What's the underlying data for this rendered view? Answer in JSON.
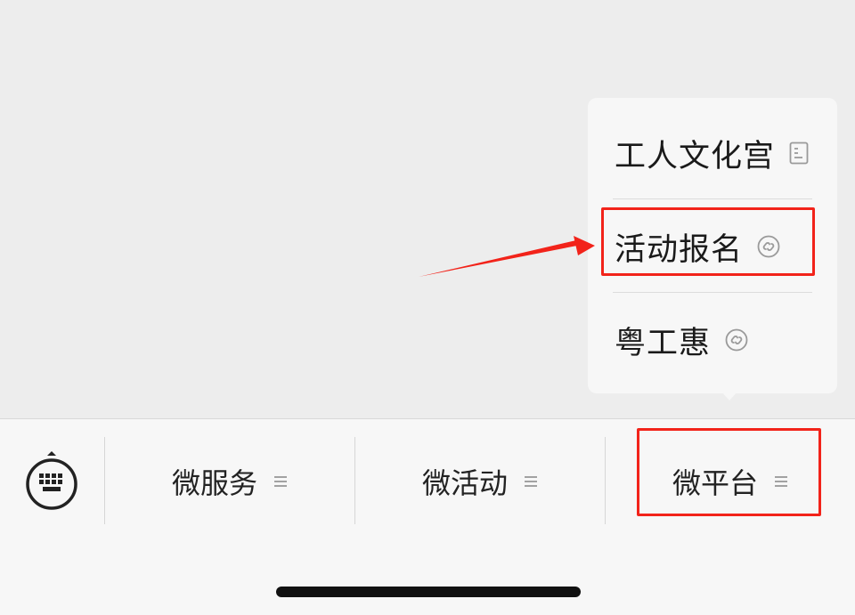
{
  "popup_menu": {
    "items": [
      {
        "label": "工人文化宫",
        "icon": "document-icon"
      },
      {
        "label": "活动报名",
        "icon": "mini-program-link-icon"
      },
      {
        "label": "粤工惠",
        "icon": "mini-program-link-icon"
      }
    ]
  },
  "tabbar": {
    "keyboard_icon": "keyboard-toggle-icon",
    "tabs": [
      {
        "label": "微服务",
        "icon": "menu-lines-icon"
      },
      {
        "label": "微活动",
        "icon": "menu-lines-icon"
      },
      {
        "label": "微平台",
        "icon": "menu-lines-icon"
      }
    ]
  },
  "colors": {
    "annotation": "#f2231a",
    "background": "#ededed",
    "menu_bg": "#f7f7f7"
  }
}
